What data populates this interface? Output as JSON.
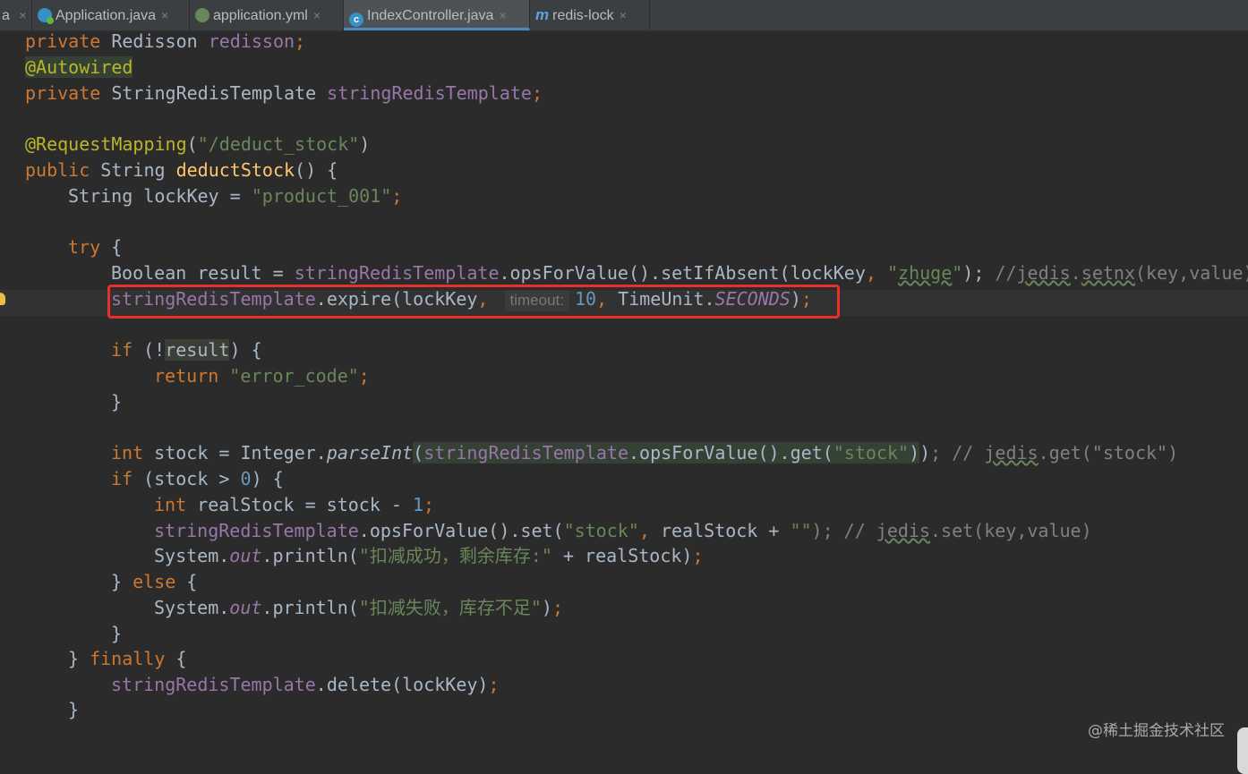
{
  "tabs": [
    {
      "label": "a",
      "icon": "none"
    },
    {
      "label": "Application.java",
      "icon": "java-class-run-icon"
    },
    {
      "label": "application.yml",
      "icon": "spring-yml-icon"
    },
    {
      "label": "IndexController.java",
      "icon": "class-c-icon",
      "active": true
    },
    {
      "label": "redis-lock",
      "icon": "maven-m-icon"
    }
  ],
  "tab_close_glyph": "×",
  "icon_glyphs": {
    "class": "c",
    "maven": "m"
  },
  "code": {
    "l1": {
      "a": "private",
      "b": " Redisson ",
      "c": "redisson",
      "d": ";"
    },
    "l2": {
      "a": "@Autowired"
    },
    "l3": {
      "a": "private",
      "b": " StringRedisTemplate ",
      "c": "stringRedisTemplate",
      "d": ";"
    },
    "l5": {
      "a": "@RequestMapping",
      "b": "(",
      "c": "\"/deduct_stock\"",
      "d": ")"
    },
    "l6": {
      "a": "public",
      "b": " String ",
      "c": "deductStock",
      "d": "() {"
    },
    "l7": {
      "a": "String lockKey = ",
      "b": "\"product_001\"",
      "c": ";"
    },
    "l9": {
      "a": "try",
      "b": " {"
    },
    "l10": {
      "a": "Boolean result = ",
      "b": "stringRedisTemplate",
      "c": ".opsForValue().setIfAbsent(lockKey",
      "d": ", ",
      "e": "\"",
      "f": "zhuge",
      "g": "\"",
      "h": "); ",
      "i": "//",
      "j": "jedis",
      "k": ".",
      "l": "setnx",
      "m": "(key,value)"
    },
    "l11": {
      "a": "stringRedisTemplate",
      "b": ".expire(lockKey",
      "c": ", ",
      "hint": "timeout:",
      "d": "10",
      "e": ", ",
      "f": "TimeUnit.",
      "g": "SECONDS",
      "h": ")",
      "i": ";"
    },
    "l13": {
      "a": "if",
      "b": " (!",
      "c": "result",
      "d": ") {"
    },
    "l14": {
      "a": "return",
      "b": " \"error_code\"",
      "c": ";"
    },
    "l15": {
      "a": "}"
    },
    "l17": {
      "a": "int",
      "b": " stock = Integer.",
      "c": "parseInt",
      "d": "(",
      "e": "stringRedisTemplate",
      "f": ".opsForValue().get(",
      "g": "\"stock\"",
      "h": ")",
      "i": ")",
      "j": "; // ",
      "k": "jedis",
      "l": ".get(\"stock\")"
    },
    "l18": {
      "a": "if",
      "b": " (stock > ",
      "c": "0",
      "d": ") {"
    },
    "l19": {
      "a": "int",
      "b": " realStock = stock - ",
      "c": "1",
      "d": ";"
    },
    "l20": {
      "a": "stringRedisTemplate",
      "b": ".opsForValue().set(",
      "c": "\"stock\"",
      "d": ", ",
      "e": "realStock + ",
      "f": "\"\"",
      "g": "); // ",
      "h": "jedis",
      "i": ".set(key,value)"
    },
    "l21": {
      "a": "System.",
      "b": "out",
      "c": ".println(",
      "d": "\"扣减成功，剩余库存:\"",
      "e": " + realStock)",
      "f": ";"
    },
    "l22": {
      "a": "} ",
      "b": "else",
      "c": " {"
    },
    "l23": {
      "a": "System.",
      "b": "out",
      "c": ".println(",
      "d": "\"扣减失败，库存不足\"",
      "e": ")",
      "f": ";"
    },
    "l24": {
      "a": "}"
    },
    "l25": {
      "a": "} ",
      "b": "finally",
      "c": " {"
    },
    "l26": {
      "a": "stringRedisTemplate",
      "b": ".delete(lockKey)",
      "c": ";"
    },
    "l27": {
      "a": "}"
    }
  },
  "watermark": "@稀土掘金技术社区",
  "colors": {
    "highlight_box": "#e8302b",
    "keyword": "#cc7832",
    "string": "#6a8759",
    "field": "#9876aa",
    "method": "#ffc66d"
  }
}
